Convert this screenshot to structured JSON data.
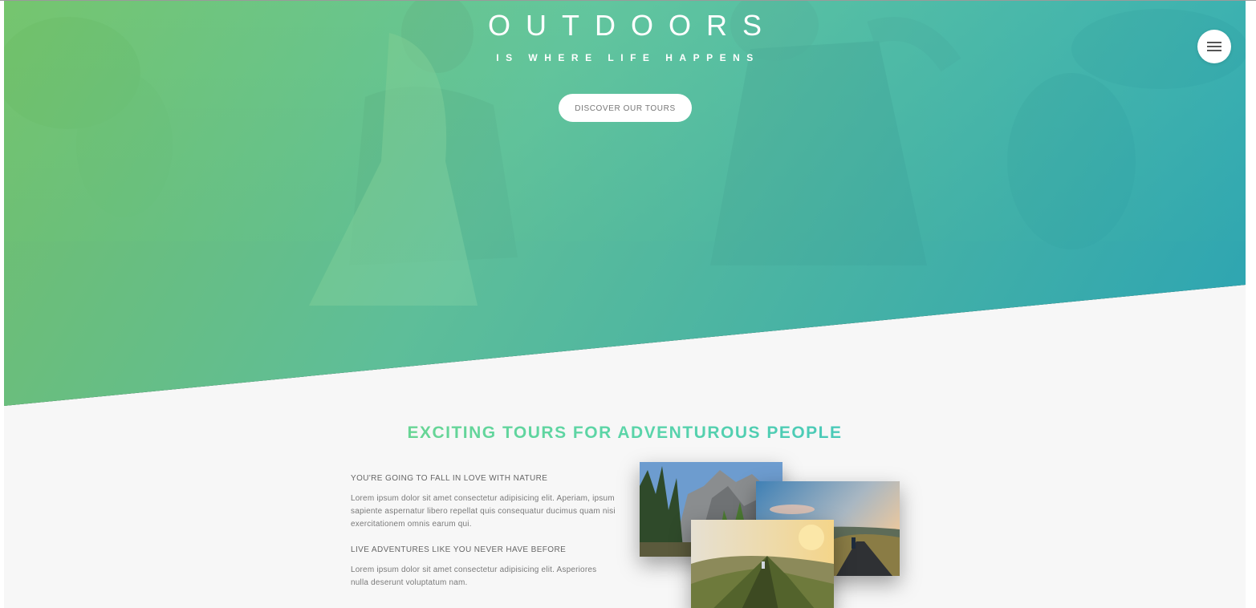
{
  "hero": {
    "title": "OUTDOORS",
    "subtitle": "IS WHERE LIFE HAPPENS",
    "cta_label": "DISCOVER OUR TOURS",
    "gradient": [
      "#7ed56f",
      "#28b485"
    ],
    "menu_icon": "hamburger-menu-icon"
  },
  "about": {
    "heading": "EXCITING TOURS FOR ADVENTUROUS PEOPLE",
    "blocks": [
      {
        "title": "YOU'RE GOING TO FALL IN LOVE WITH NATURE",
        "text": "Lorem ipsum dolor sit amet consectetur adipisicing elit. Aperiam, ipsum sapiente aspernatur libero repellat quis consequatur ducimus quam nisi exercitationem omnis earum qui."
      },
      {
        "title": "LIVE ADVENTURES LIKE YOU NEVER HAVE BEFORE",
        "text": "Lorem ipsum dolor sit amet consectetur adipisicing elit. Asperiores nulla deserunt voluptatum nam."
      }
    ],
    "photos": [
      "mountain-valley-photo",
      "hiker-road-photo",
      "mountain-ridge-photo"
    ]
  }
}
